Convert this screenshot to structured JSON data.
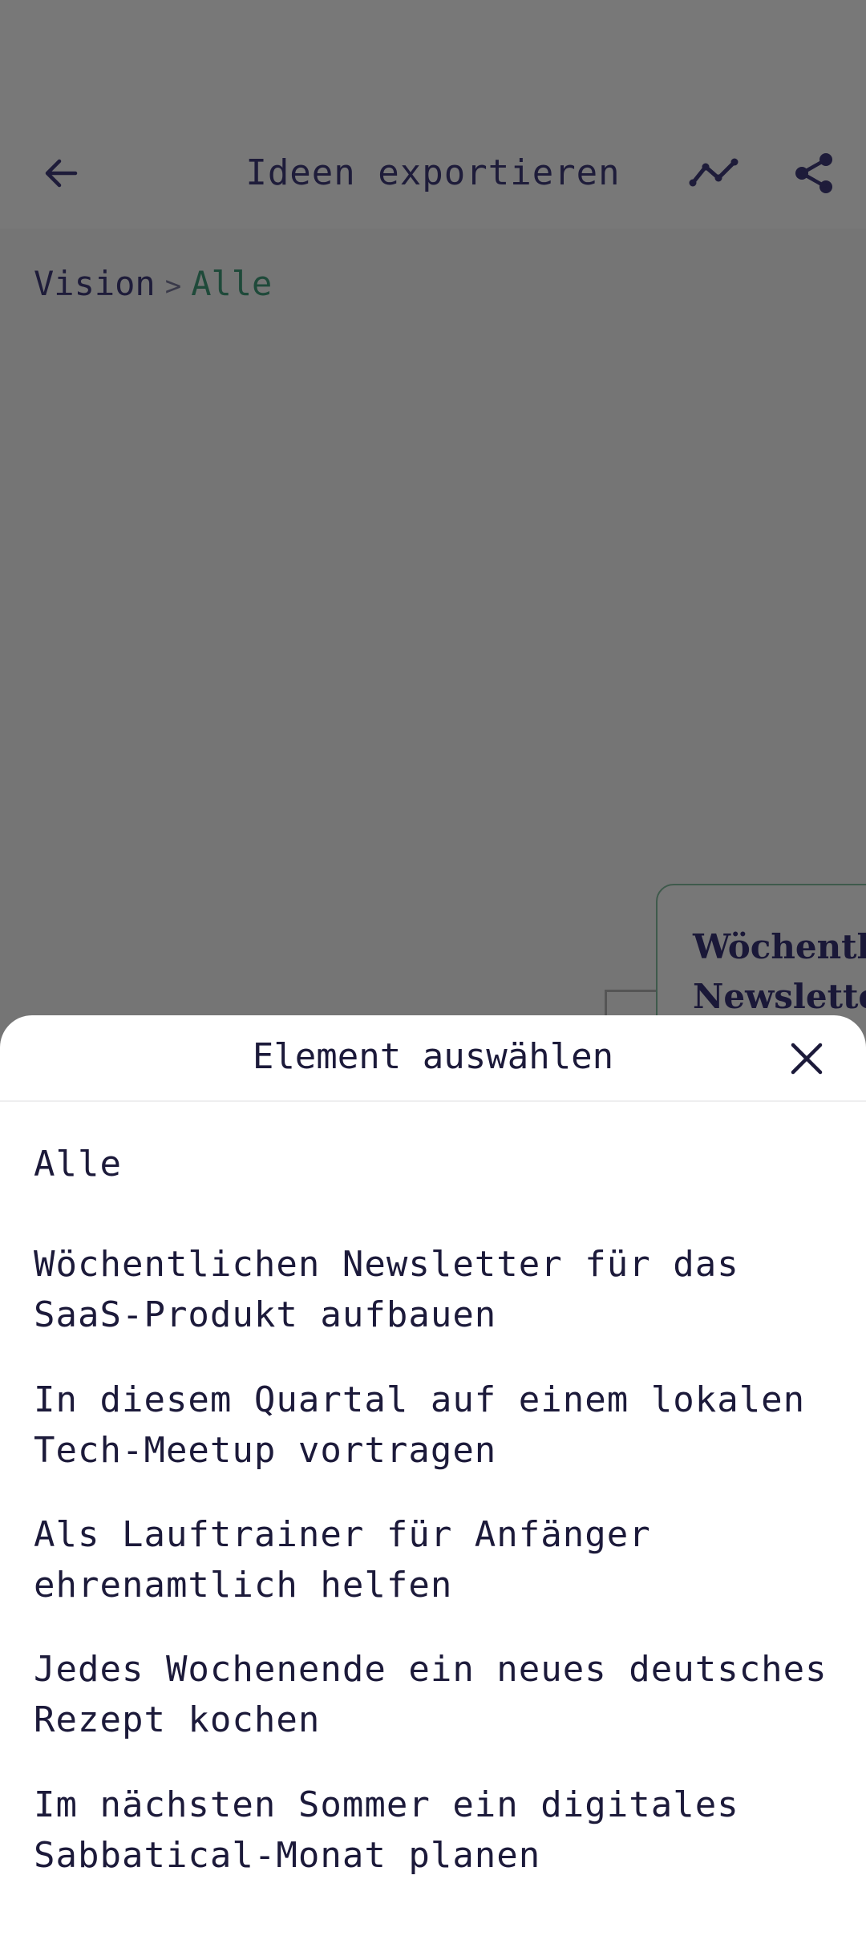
{
  "header": {
    "title": "Ideen exportieren",
    "back_icon": "arrow-left-icon",
    "trend_icon": "trend-line-icon",
    "share_icon": "share-icon"
  },
  "breadcrumb": {
    "root": "Vision",
    "separator": ">",
    "current": "Alle"
  },
  "map_node": {
    "title_line1": "Wöchentlichen",
    "title_line2": "Newsletter"
  },
  "sheet": {
    "title": "Element auswählen",
    "close_icon": "close-icon",
    "items": [
      {
        "label": "Alle"
      },
      {
        "label": "Wöchentlichen Newsletter für das SaaS-Produkt aufbauen"
      },
      {
        "label": "In diesem Quartal auf einem lokalen Tech-Meetup vortragen"
      },
      {
        "label": "Als Lauftrainer für Anfänger ehrenamtlich helfen"
      },
      {
        "label": "Jedes Wochenende ein neues deutsches Rezept kochen"
      },
      {
        "label": "Im nächsten Sommer ein digitales Sabbatical-Monat planen"
      }
    ]
  },
  "colors": {
    "overlay_background": "#757575",
    "text_primary": "#1c1a3a",
    "breadcrumb_active": "#1f4a3a",
    "sheet_background": "#ffffff"
  }
}
